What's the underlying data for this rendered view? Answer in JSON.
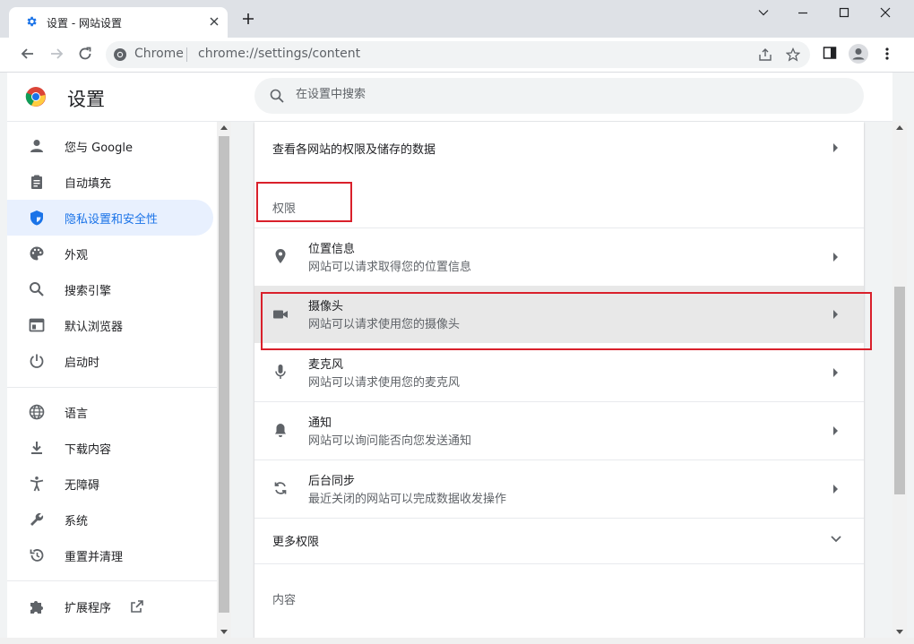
{
  "tab": {
    "title": "设置 - 网站设置",
    "icon": "gear-icon"
  },
  "toolbar": {
    "site_label": "Chrome",
    "url": "chrome://settings/content"
  },
  "header": {
    "title": "设置",
    "search_placeholder": "在设置中搜索"
  },
  "sidebar": {
    "items": [
      {
        "label": "您与 Google",
        "icon": "person-icon"
      },
      {
        "label": "自动填充",
        "icon": "clipboard-icon"
      },
      {
        "label": "隐私设置和安全性",
        "icon": "shield-icon",
        "active": true
      },
      {
        "label": "外观",
        "icon": "palette-icon"
      },
      {
        "label": "搜索引擎",
        "icon": "search-icon"
      },
      {
        "label": "默认浏览器",
        "icon": "browser-icon"
      },
      {
        "label": "启动时",
        "icon": "power-icon"
      },
      {
        "label": "语言",
        "icon": "globe-icon"
      },
      {
        "label": "下载内容",
        "icon": "download-icon"
      },
      {
        "label": "无障碍",
        "icon": "accessibility-icon"
      },
      {
        "label": "系统",
        "icon": "wrench-icon"
      },
      {
        "label": "重置并清理",
        "icon": "restore-icon"
      },
      {
        "label": "扩展程序",
        "icon": "puzzle-icon"
      }
    ]
  },
  "main": {
    "top_row": "查看各网站的权限及储存的数据",
    "permissions_label": "权限",
    "permissions": [
      {
        "title": "位置信息",
        "subtitle": "网站可以请求取得您的位置信息",
        "icon": "location-pin-icon"
      },
      {
        "title": "摄像头",
        "subtitle": "网站可以请求使用您的摄像头",
        "icon": "camera-icon"
      },
      {
        "title": "麦克风",
        "subtitle": "网站可以请求使用您的麦克风",
        "icon": "microphone-icon"
      },
      {
        "title": "通知",
        "subtitle": "网站可以询问能否向您发送通知",
        "icon": "bell-icon"
      },
      {
        "title": "后台同步",
        "subtitle": "最近关闭的网站可以完成数据收发操作",
        "icon": "sync-icon"
      }
    ],
    "more_permissions": "更多权限",
    "content_label": "内容"
  },
  "colors": {
    "accent": "#1a73e8",
    "highlight": "#d9202b",
    "active_bg": "#e8f0fe",
    "hover_row": "#e8e8e8"
  }
}
